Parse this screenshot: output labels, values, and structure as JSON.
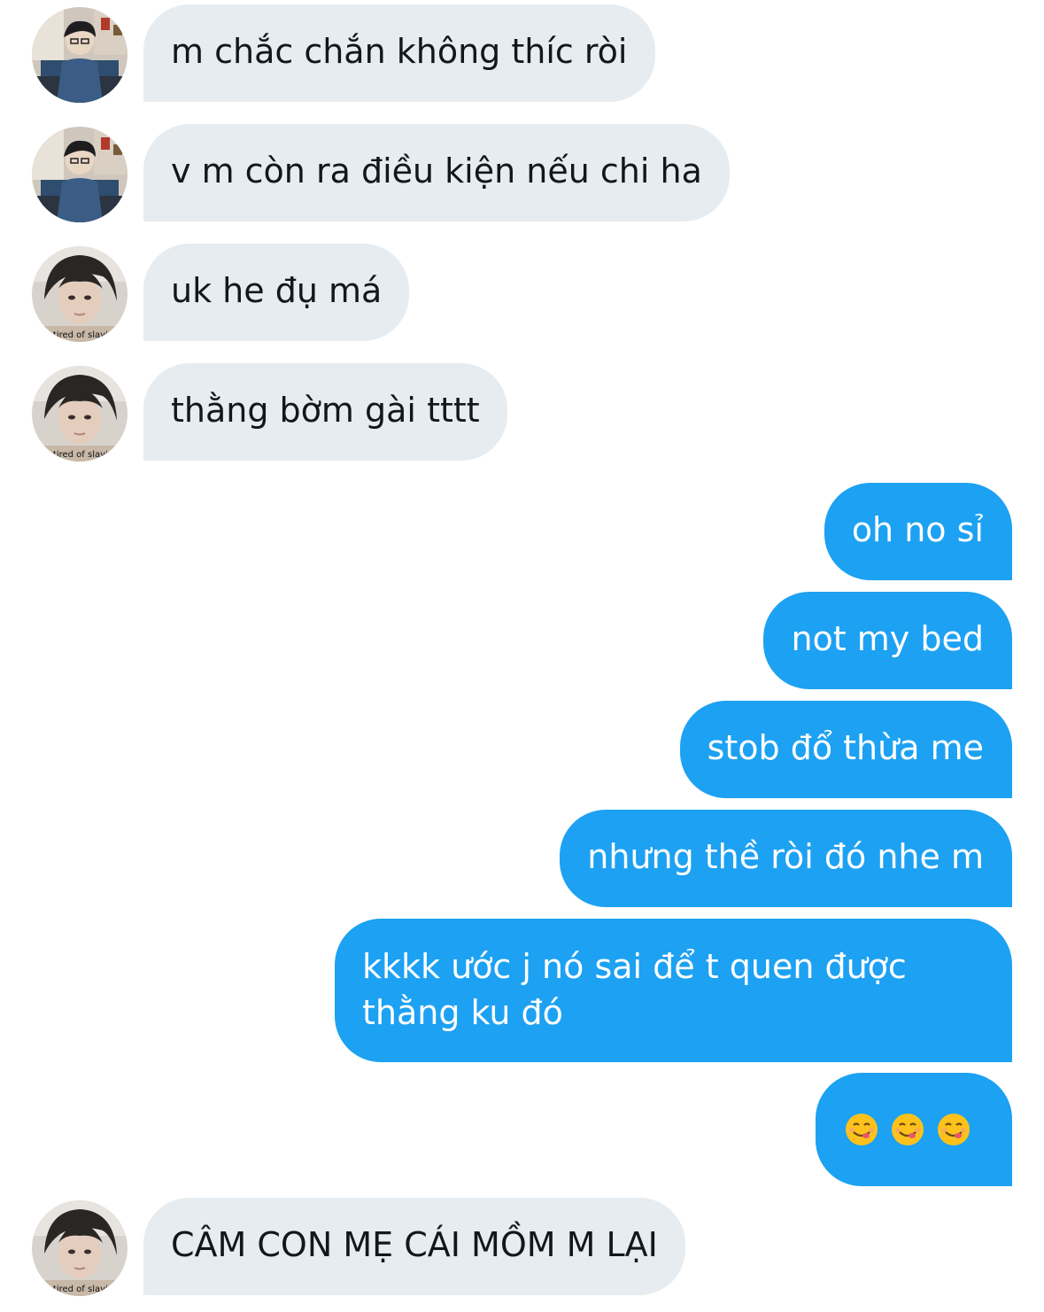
{
  "conversation": {
    "messages": [
      {
        "sender": "other",
        "avatar": "avatar-a",
        "text": "m chắc chắn không thíc ròi"
      },
      {
        "sender": "other",
        "avatar": "avatar-a",
        "text": "v m còn ra điều kiện nếu chi ha"
      },
      {
        "sender": "other",
        "avatar": "avatar-b",
        "text": "uk he đụ má"
      },
      {
        "sender": "other",
        "avatar": "avatar-b",
        "text": "thằng bờm gài tttt"
      },
      {
        "sender": "me",
        "text": "oh no sỉ"
      },
      {
        "sender": "me",
        "text": "not my bed"
      },
      {
        "sender": "me",
        "text": "stob đổ thừa me"
      },
      {
        "sender": "me",
        "text": "nhưng thề ròi đó nhe m"
      },
      {
        "sender": "me",
        "text": "kkkk ước j nó sai để t quen được thằng ku đó"
      },
      {
        "sender": "me",
        "text": "😋😋😋",
        "emoji_names": [
          "yum-emoji",
          "yum-emoji",
          "yum-emoji"
        ]
      },
      {
        "sender": "other",
        "avatar": "avatar-b",
        "text": "CÂM CON MẸ CÁI MỒM M LẠI"
      }
    ]
  },
  "avatar_b_caption": "i'm tired of slaying",
  "colors": {
    "incoming_bubble": "#e6ecf0",
    "outgoing_bubble": "#1da1f2",
    "incoming_text": "#14171a",
    "outgoing_text": "#ffffff"
  }
}
